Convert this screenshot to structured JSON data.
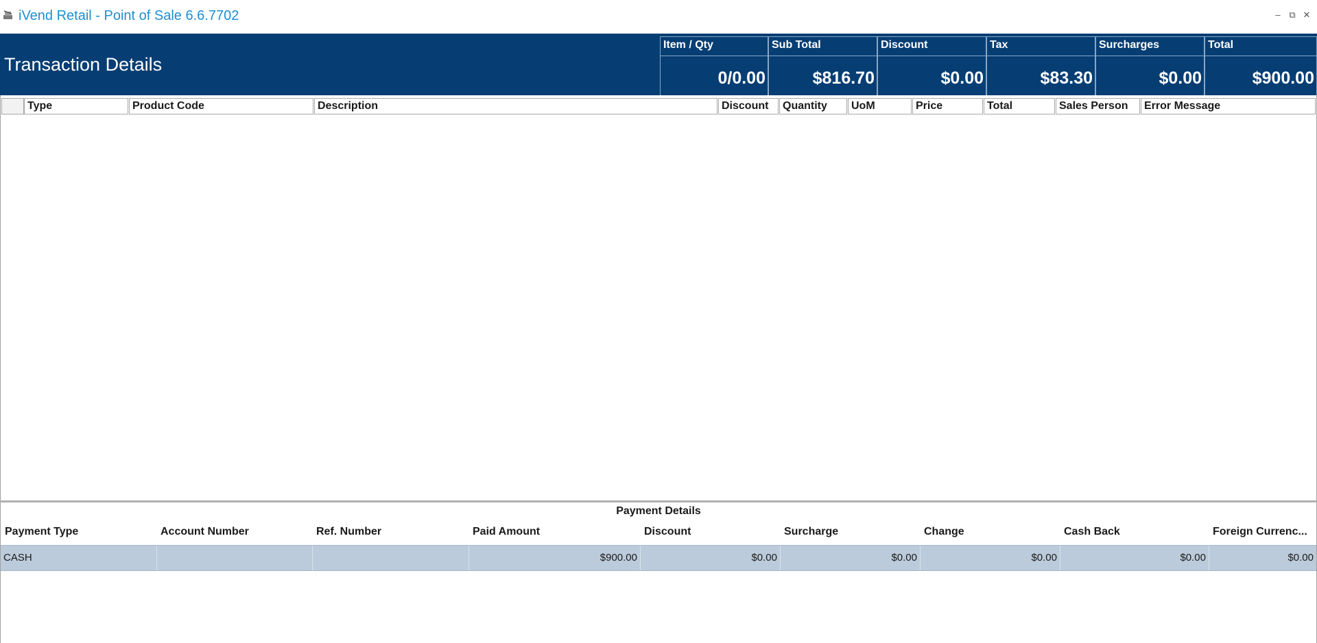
{
  "window": {
    "title": "iVend Retail - Point of Sale 6.6.7702",
    "icon": "pos-terminal-icon",
    "controls": {
      "minimize": "–",
      "maximize": "⧉",
      "close": "✕"
    }
  },
  "header": {
    "title": "Transaction Details",
    "background": "#063e74",
    "summary": [
      {
        "label": "Item / Qty",
        "value": "0/0.00"
      },
      {
        "label": "Sub Total",
        "value": "$816.70"
      },
      {
        "label": "Discount",
        "value": "$0.00"
      },
      {
        "label": "Tax",
        "value": "$83.30"
      },
      {
        "label": "Surcharges",
        "value": "$0.00"
      },
      {
        "label": "Total",
        "value": "$900.00"
      }
    ]
  },
  "transaction_grid": {
    "columns": [
      "Type",
      "Product Code",
      "Description",
      "Discount",
      "Quantity",
      "UoM",
      "Price",
      "Total",
      "Sales Person",
      "Error Message"
    ],
    "rows": []
  },
  "payment_details": {
    "title": "Payment Details",
    "columns": [
      "Payment Type",
      "Account Number",
      "Ref. Number",
      "Paid Amount",
      "Discount",
      "Surcharge",
      "Change",
      "Cash Back",
      "Foreign Currenc..."
    ],
    "rows": [
      {
        "payment_type": "CASH",
        "account_number": "",
        "ref_number": "",
        "paid_amount": "$900.00",
        "discount": "$0.00",
        "surcharge": "$0.00",
        "change": "$0.00",
        "cash_back": "$0.00",
        "foreign_currency": "$0.00"
      }
    ],
    "selected_row_color": "#bccbdb"
  }
}
